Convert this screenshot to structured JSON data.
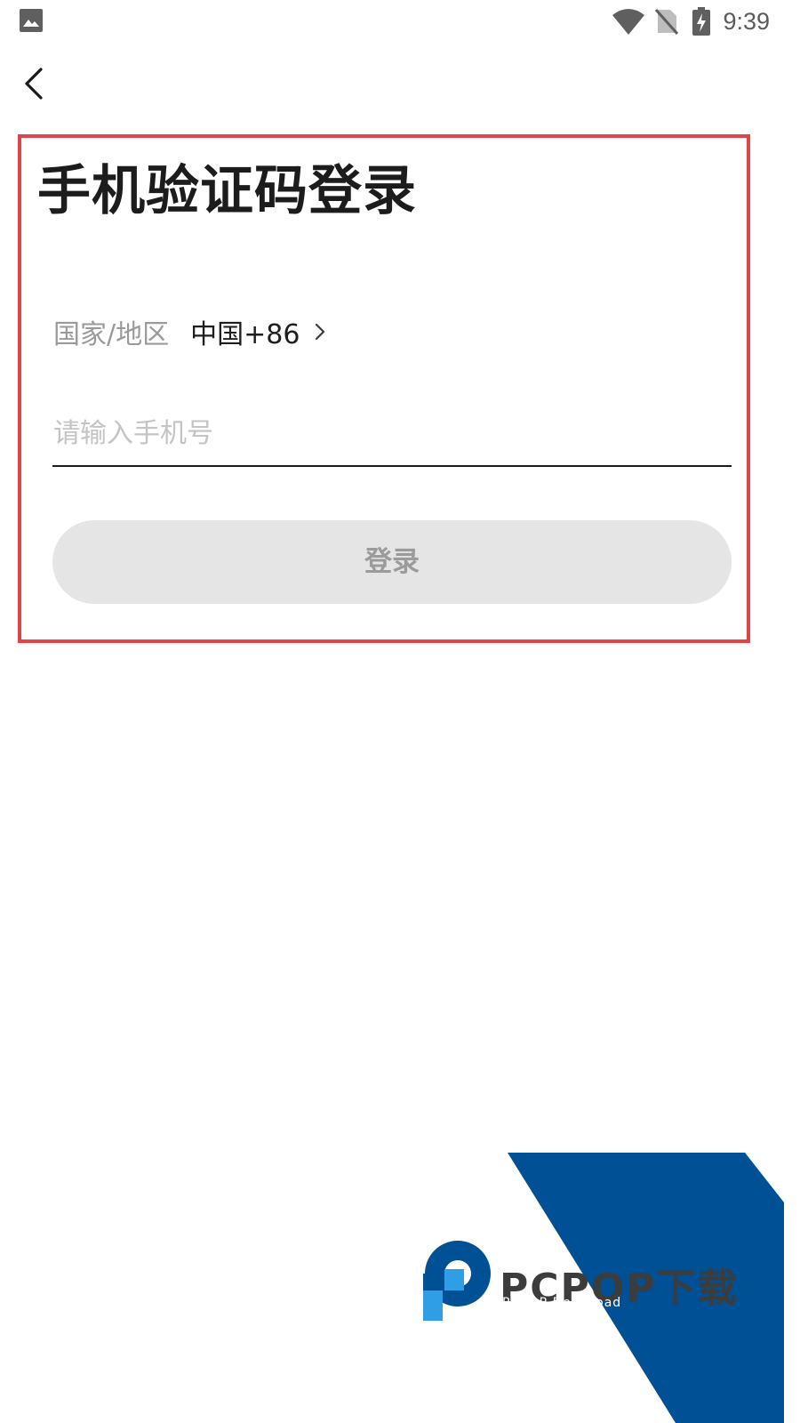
{
  "status_bar": {
    "time": "9:39",
    "icons": [
      "gallery-icon",
      "wifi-icon",
      "no-sim-icon",
      "battery-charging-icon"
    ]
  },
  "nav": {
    "back_icon": "chevron-left-icon"
  },
  "login": {
    "title": "手机验证码登录",
    "region_label": "国家/地区",
    "region_value": "中国+86",
    "phone_placeholder": "请输入手机号",
    "phone_value": "",
    "submit_label": "登录"
  },
  "watermark": {
    "brand": "PCPOP下载",
    "sub": "PCPOP Download"
  },
  "colors": {
    "highlight": "#e04448",
    "button_bg": "#e5e5e5",
    "watermark_blue": "#005096"
  }
}
